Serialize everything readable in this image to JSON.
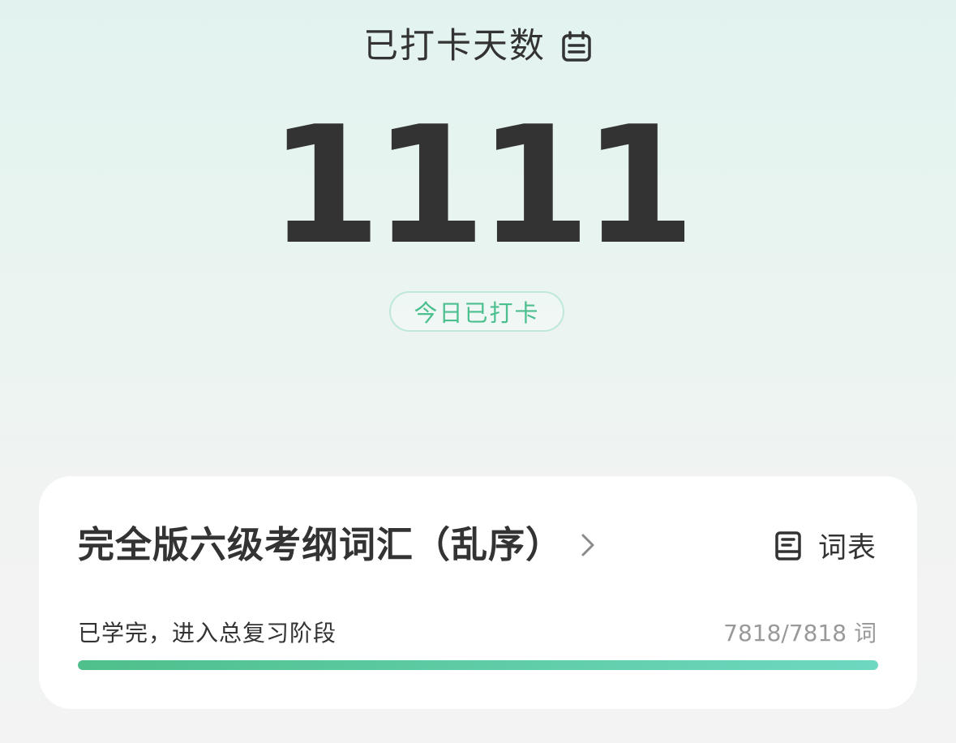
{
  "checkin": {
    "title": "已打卡天数",
    "days": "1111",
    "today_badge": "今日已打卡"
  },
  "book": {
    "title": "完全版六级考纲词汇（乱序）",
    "wordlist_label": "词表",
    "status_text": "已学完，进入总复习阶段",
    "progress_text": "7818/7818 词",
    "learned": 7818,
    "total": 7818
  },
  "colors": {
    "accent": "#4cbf8f",
    "progress_start": "#4fbf8b",
    "progress_end": "#6ed8c0",
    "text_primary": "#333333",
    "text_secondary": "#999999"
  },
  "icons": {
    "calendar": "calendar-icon",
    "chevron": "chevron-right-icon",
    "wordlist": "wordlist-icon"
  }
}
